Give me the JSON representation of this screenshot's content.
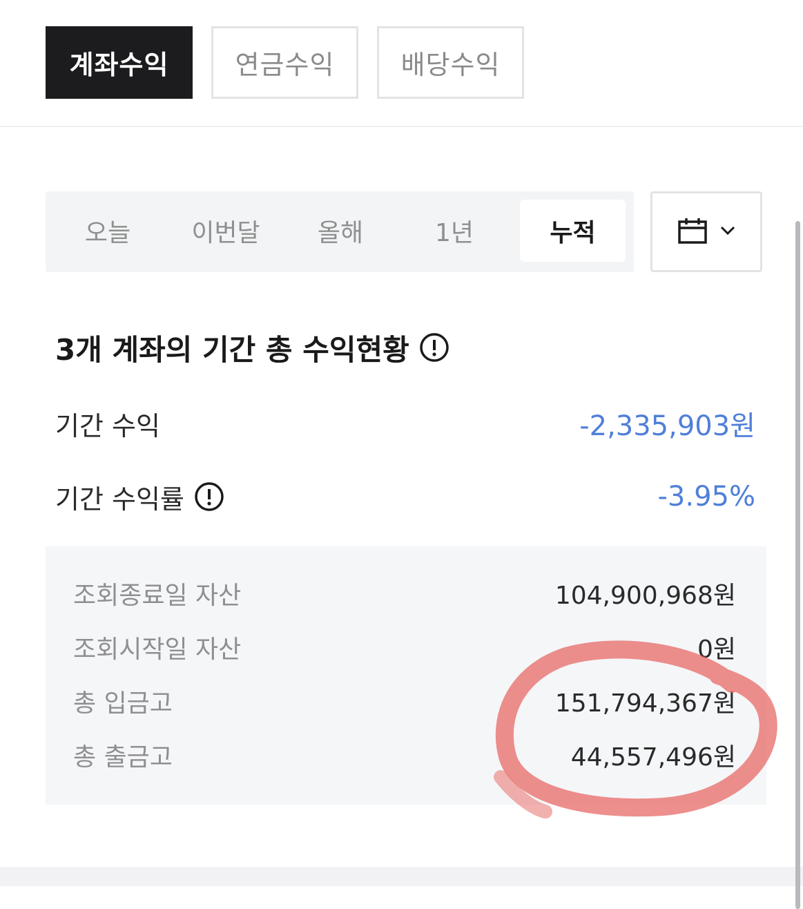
{
  "top_tabs": [
    {
      "label": "계좌수익",
      "active": true
    },
    {
      "label": "연금수익",
      "active": false
    },
    {
      "label": "배당수익",
      "active": false
    }
  ],
  "period": {
    "options": [
      {
        "label": "오늘",
        "active": false
      },
      {
        "label": "이번달",
        "active": false
      },
      {
        "label": "올해",
        "active": false
      },
      {
        "label": "1년",
        "active": false
      },
      {
        "label": "누적",
        "active": true
      }
    ],
    "calendar_icon": "calendar-icon",
    "dropdown_icon": "chevron-down-icon"
  },
  "summary": {
    "title": "3개 계좌의 기간 총 수익현황",
    "title_icon": "info-icon",
    "period_profit_label": "기간 수익",
    "period_profit_value": "-2,335,903원",
    "period_return_label": "기간 수익률",
    "period_return_value": "-3.95%",
    "value_color": "#4f7fd8"
  },
  "details": [
    {
      "label": "조회종료일 자산",
      "value": "104,900,968원"
    },
    {
      "label": "조회시작일 자산",
      "value": "0원"
    },
    {
      "label": "총 입금고",
      "value": "151,794,367원"
    },
    {
      "label": "총 출금고",
      "value": "44,557,496원"
    }
  ],
  "colors": {
    "active_tab_bg": "#1c1c1e",
    "annotation": "#e8706c"
  }
}
